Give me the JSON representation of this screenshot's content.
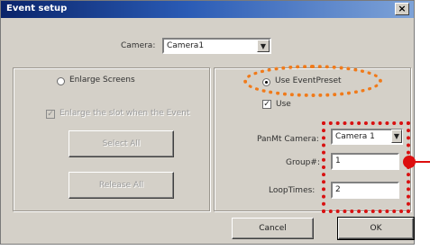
{
  "window": {
    "title": "Event setup",
    "close_glyph": "×"
  },
  "camera": {
    "label": "Camera:",
    "value": "Camera1",
    "dropdown_icon": "chevron-down"
  },
  "left_group": {
    "enlarge_label": "Enlarge Screens",
    "enlarge_checked": false,
    "sub_checkbox_label": "Enlarge the slot when the Event",
    "sub_checkbox_checked": true,
    "select_button": "Select All",
    "release_button": "Release All"
  },
  "right_group": {
    "use_event_preset_label": "Use EventPreset",
    "use_event_preset_checked": true,
    "use_label": "Use",
    "use_checked": true,
    "pantilt_label": "PanMt Camera:",
    "pantilt_value": "Camera 1",
    "group_label": "Group#:",
    "group_value": "1",
    "looptimes_label": "LoopTimes:",
    "looptimes_value": "2"
  },
  "footer": {
    "cancel": "Cancel",
    "ok": "OK"
  },
  "colors": {
    "title_bar": "#0a246a",
    "dialog_face": "#d4d0c8",
    "highlight_ellipse": "#f07a1a",
    "highlight_box": "#d81111"
  }
}
